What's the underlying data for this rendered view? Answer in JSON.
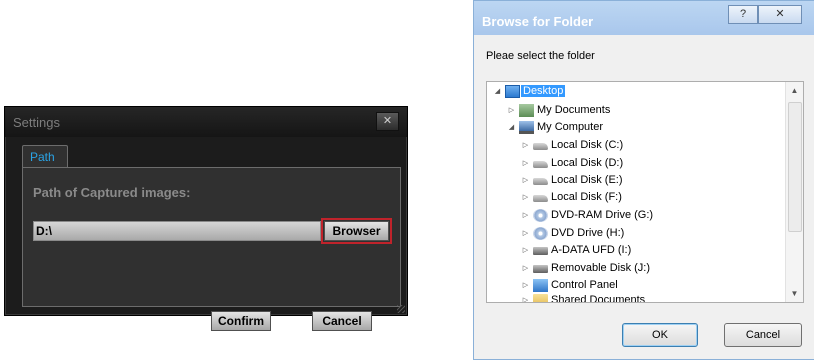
{
  "settings": {
    "title": "Settings",
    "close_glyph": "✕",
    "tab": "Path",
    "path_label": "Path of Captured images:",
    "path_value": "D:\\",
    "browser_button": "Browser",
    "confirm_button": "Confirm",
    "cancel_button": "Cancel"
  },
  "browse": {
    "title": "Browse for Folder",
    "help_glyph": "?",
    "close_glyph": "✕",
    "prompt": "Pleae select the folder",
    "tree": [
      {
        "label": "Desktop",
        "icon": "desktop-icon"
      },
      {
        "label": "My Documents",
        "icon": "documents-icon"
      },
      {
        "label": "My Computer",
        "icon": "computer-icon"
      },
      {
        "label": "Local Disk (C:)",
        "icon": "drive-icon"
      },
      {
        "label": "Local Disk (D:)",
        "icon": "drive-icon"
      },
      {
        "label": "Local Disk (E:)",
        "icon": "drive-icon"
      },
      {
        "label": "Local Disk (F:)",
        "icon": "drive-icon"
      },
      {
        "label": "DVD-RAM Drive (G:)",
        "icon": "dvd-icon"
      },
      {
        "label": "DVD Drive (H:)",
        "icon": "dvd-icon"
      },
      {
        "label": "A-DATA UFD (I:)",
        "icon": "usb-drive-icon"
      },
      {
        "label": "Removable Disk (J:)",
        "icon": "usb-drive-icon"
      },
      {
        "label": "Control Panel",
        "icon": "control-panel-icon"
      },
      {
        "label": "Shared Documents",
        "icon": "folder-icon"
      }
    ],
    "ok_button": "OK",
    "cancel_button": "Cancel",
    "selection_color": "#3399ff"
  }
}
